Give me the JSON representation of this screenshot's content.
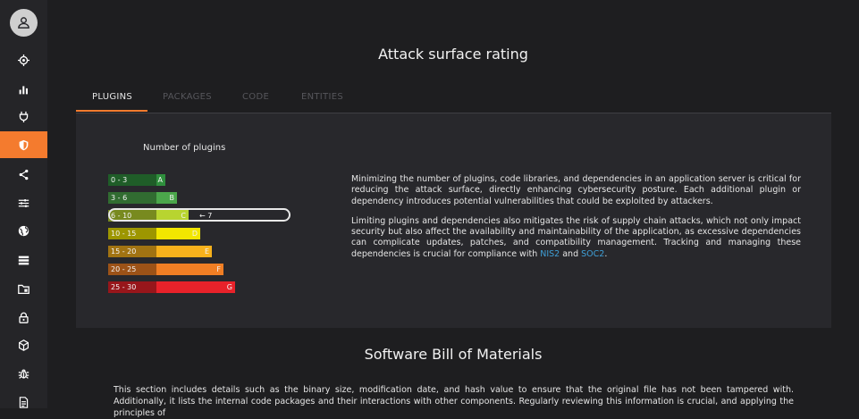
{
  "sidebar": {
    "items": [
      {
        "icon": "target-icon"
      },
      {
        "icon": "bar-chart-icon"
      },
      {
        "icon": "plug-icon"
      },
      {
        "icon": "shield-icon",
        "active": true
      },
      {
        "icon": "share-icon"
      },
      {
        "icon": "sliders-icon"
      },
      {
        "icon": "globe-icon"
      },
      {
        "icon": "server-icon"
      },
      {
        "icon": "folder-icon"
      },
      {
        "icon": "lock-icon"
      },
      {
        "icon": "cube-icon"
      },
      {
        "icon": "bug-icon"
      },
      {
        "icon": "document-icon"
      }
    ],
    "accent": "#f47b2e"
  },
  "page": {
    "title": "Attack surface rating"
  },
  "tabs": [
    {
      "label": "PLUGINS",
      "active": true
    },
    {
      "label": "PACKAGES",
      "active": false
    },
    {
      "label": "CODE",
      "active": false
    },
    {
      "label": "ENTITIES",
      "active": false
    }
  ],
  "rating": {
    "title": "Number of plugins",
    "bands": [
      {
        "range": "0 - 3",
        "grade": "A",
        "color": "#2f8f3d"
      },
      {
        "range": "3 - 6",
        "grade": "B",
        "color": "#4ba64b"
      },
      {
        "range": "6 - 10",
        "grade": "C",
        "color": "#b8d430"
      },
      {
        "range": "10 - 15",
        "grade": "D",
        "color": "#f2e600"
      },
      {
        "range": "15 - 20",
        "grade": "E",
        "color": "#f7b11c"
      },
      {
        "range": "20 - 25",
        "grade": "F",
        "color": "#f07e24"
      },
      {
        "range": "25 - 30",
        "grade": "G",
        "color": "#e8222a"
      }
    ],
    "current_grade": "C",
    "current_value_label": "← 7"
  },
  "description": {
    "p1": "Minimizing the number of plugins, code libraries, and dependencies in an application server is critical for reducing the attack surface, directly enhancing cybersecurity posture. Each additional plugin or dependency introduces potential vulnerabilities that could be exploited by attackers.",
    "p2_text": "Limiting plugins and dependencies also mitigates the risk of supply chain attacks, which not only impact security but also affect the availability and maintainability of the application, as excessive dependencies can complicate updates, patches, and compatibility management. Tracking and managing these dependencies is crucial for compliance with ",
    "link1": "NIS2",
    "and_text": " and ",
    "link2": "SOC2",
    "end_text": "."
  },
  "sbom": {
    "title": "Software Bill of Materials",
    "text": "This section includes details such as the binary size, modification date, and hash value to ensure that the original file has not been tampered with. Additionally, it lists the internal code packages and their interactions with other components. Regularly reviewing this information is crucial, and applying the principles of"
  }
}
